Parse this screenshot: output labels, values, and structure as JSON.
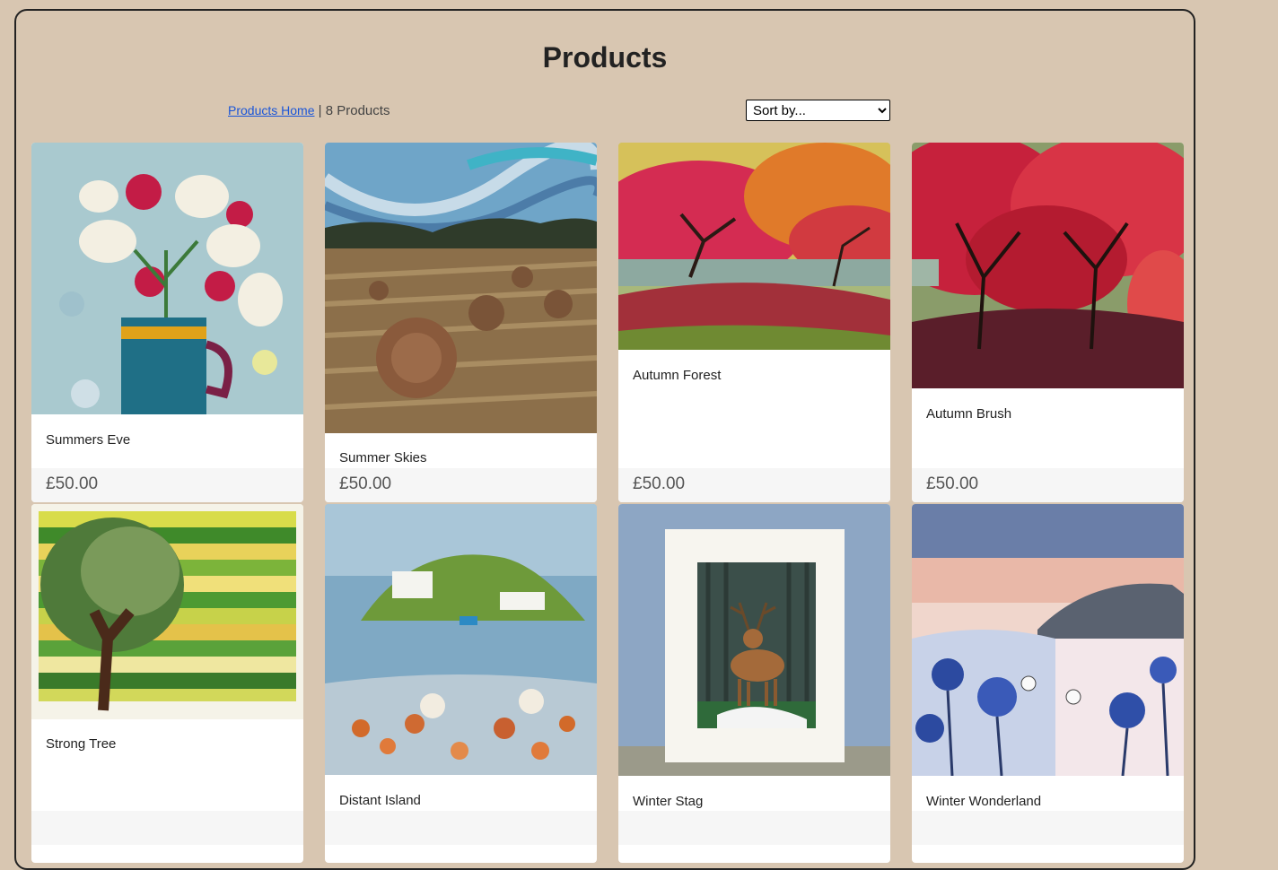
{
  "page": {
    "title": "Products",
    "breadcrumb_link": "Products Home",
    "separator": "|",
    "count_text": "8 Products"
  },
  "sort": {
    "selected": "Sort by..."
  },
  "products": [
    {
      "name": "Summers Eve",
      "price": "£50.00",
      "image": "flowers-in-jug-painting"
    },
    {
      "name": "Summer Skies",
      "price": "£50.00",
      "image": "hay-bales-field-painting"
    },
    {
      "name": "Autumn Forest",
      "price": "£50.00",
      "image": "red-maple-trees-painting"
    },
    {
      "name": "Autumn Brush",
      "price": "£50.00",
      "image": "red-autumn-trees-painting"
    },
    {
      "name": "Strong Tree",
      "price": "",
      "image": "tree-on-striped-field-painting"
    },
    {
      "name": "Distant Island",
      "price": "",
      "image": "island-and-wildflowers-painting"
    },
    {
      "name": "Winter Stag",
      "price": "",
      "image": "stag-in-forest-mounted-print"
    },
    {
      "name": "Winter Wonderland",
      "price": "",
      "image": "blue-thistles-landscape-painting"
    }
  ],
  "colors": {
    "background": "#d8c6b1",
    "link": "#1a55d8",
    "card": "#ffffff",
    "price_bar": "#f6f6f6"
  }
}
